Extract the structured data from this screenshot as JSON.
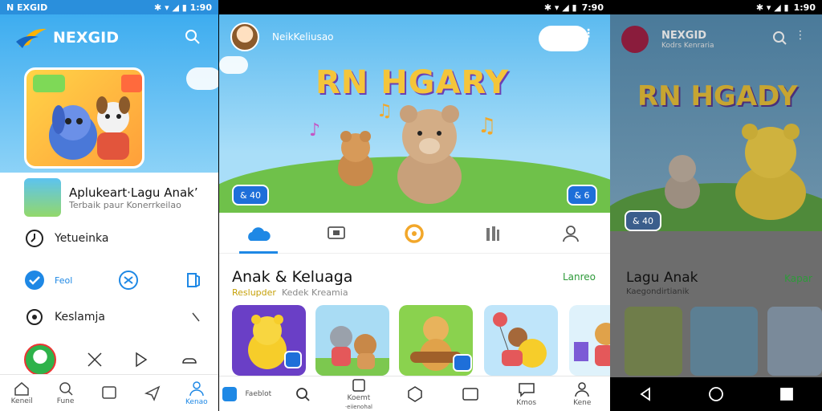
{
  "panel1": {
    "status_title": "N EXGID",
    "status_time": "1:90",
    "brand": "NEXGID",
    "app_title": "Aplukeart·Lagu Anakʼ",
    "app_sub": "Terbaik paur Konerrkeilao",
    "menu1": "Yetueinka",
    "quick_label": "Feol",
    "menu2": "Keslamja",
    "nav": [
      "Keneil",
      "Fune",
      "",
      "",
      "Kenao"
    ]
  },
  "panel2": {
    "status_time": "7:90",
    "app_name": "NeikKeliusao",
    "headline": "RN HGARY",
    "badge_left": "& 4​0",
    "badge_right": "& 6",
    "section_title": "Anak & Keluaga",
    "section_more": "Lanreo",
    "section_sub_left": "Reslupder",
    "section_sub_right": "Kedek Kreamia",
    "nav": [
      "Faeblot",
      "",
      "Koemt",
      "",
      "",
      "Kmos",
      "Kene"
    ],
    "nav_note": "·eiienohal"
  },
  "panel3": {
    "status_time": "1:90",
    "brand": "NEXGID",
    "brand_sub": "Kodrs Kenraria",
    "headline": "RN HGADY",
    "badge": "& 40",
    "section_title": "Lagu Anak",
    "section_sub": "Kaegondirtianik",
    "section_more": "Kapar"
  },
  "colors": {
    "accent": "#1e88e5",
    "sky": "#36a9ef",
    "grass": "#6fc14a",
    "link_green": "#2e9a3a"
  }
}
